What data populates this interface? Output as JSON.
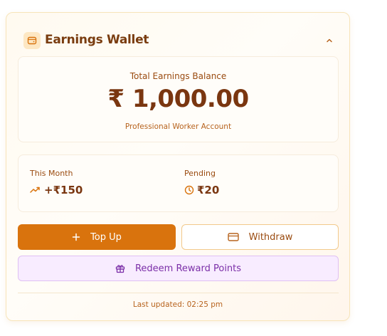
{
  "wallet": {
    "title": "Earnings Wallet",
    "icons": {
      "wallet": "wallet-icon",
      "collapse": "chevron-up-icon"
    }
  },
  "balance": {
    "label": "Total Earnings Balance",
    "amount": "₹ 1,000.00",
    "account_type": "Professional Worker Account"
  },
  "stats": {
    "this_month": {
      "label": "This Month",
      "value": "+₹150",
      "icon": "trending-up-icon"
    },
    "pending": {
      "label": "Pending",
      "value": "₹20",
      "icon": "clock-icon"
    }
  },
  "actions": {
    "top_up": {
      "label": "Top Up",
      "icon": "plus-icon"
    },
    "withdraw": {
      "label": "Withdraw",
      "icon": "credit-card-icon"
    },
    "redeem": {
      "label": "Redeem Reward Points",
      "icon": "gift-icon"
    }
  },
  "footer": {
    "last_updated": "Last updated: 02:25 pm"
  },
  "colors": {
    "accent": "#d9730d",
    "text_primary": "#7a3610",
    "text_secondary": "#9a4b10",
    "redeem_bg": "#f8ecff",
    "redeem_text": "#7b2fa8"
  }
}
